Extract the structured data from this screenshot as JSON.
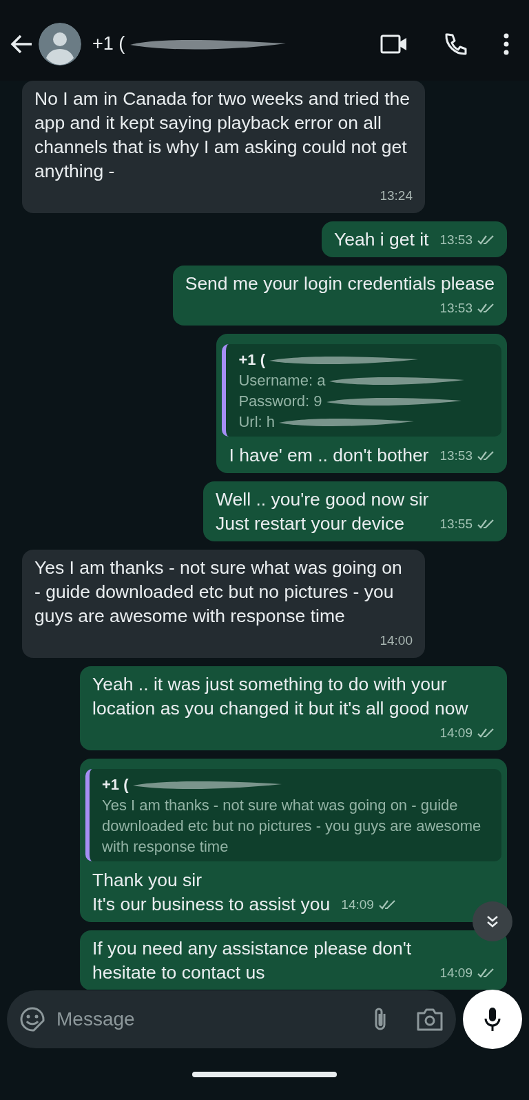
{
  "header": {
    "contact": "+1 ("
  },
  "messages": [
    {
      "kind": "in",
      "text": "No I am in  Canada for two weeks and tried the app and it kept saying playback error on all channels that is why I am asking could not get anything -",
      "time": "13:24"
    },
    {
      "kind": "out",
      "text": "Yeah i get it",
      "time": "13:53",
      "read": false,
      "inline_time": true
    },
    {
      "kind": "out",
      "text": "Send me your login credentials please",
      "time": "13:53",
      "read": false
    },
    {
      "kind": "out",
      "quote": {
        "author": "+1 (",
        "lines": [
          "Username: a",
          "Password: 9",
          "Url: h"
        ]
      },
      "text": "I have' em .. don't bother",
      "time": "13:53",
      "read": false,
      "inline_time": true
    },
    {
      "kind": "out",
      "text": "Well .. you're good now sir\nJust restart your device",
      "time": "13:55",
      "read": false,
      "inline_time": true
    },
    {
      "kind": "in",
      "text": "Yes I am thanks - not sure what was going on - guide downloaded etc but no pictures - you guys are awesome with response time",
      "time": "14:00"
    },
    {
      "kind": "out",
      "text": "Yeah .. it was just something to do with your location as you changed it but it's all good now",
      "time": "14:09",
      "read": false
    },
    {
      "kind": "out",
      "quote": {
        "author": "+1 (",
        "lines": [
          "Yes I am thanks - not sure what was going on - guide downloaded etc but no pictures - you guys are awesome with response time"
        ]
      },
      "text": "Thank you sir\nIt's our business to assist you",
      "time": "14:09",
      "read": false,
      "inline_time": true
    },
    {
      "kind": "out",
      "text": "If you need any assistance please don't hesitate to contact us",
      "time": "14:09",
      "read": false,
      "inline_time": true
    }
  ],
  "composer": {
    "placeholder": "Message"
  }
}
